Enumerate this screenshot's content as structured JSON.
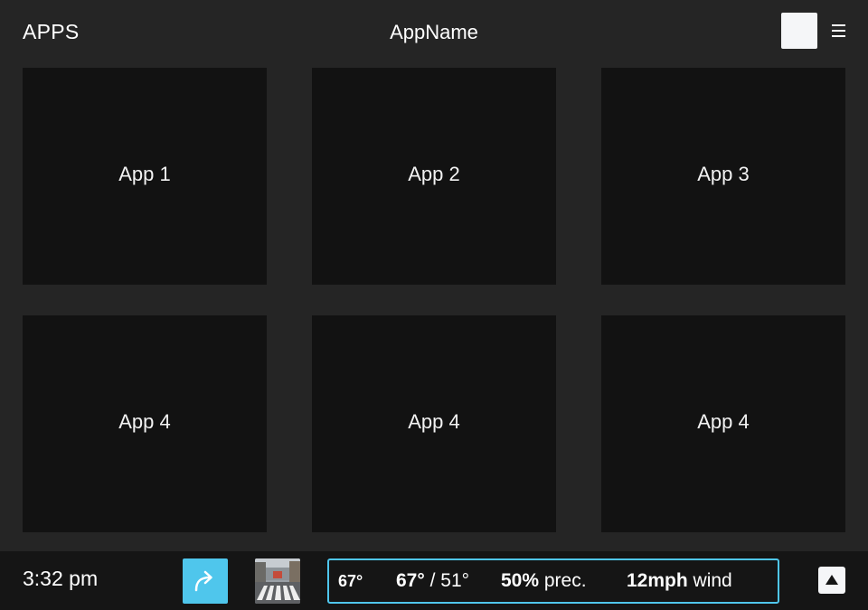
{
  "header": {
    "title": "APPS",
    "app_name": "AppName"
  },
  "tiles": [
    {
      "label": "App 1"
    },
    {
      "label": "App 2"
    },
    {
      "label": "App 3"
    },
    {
      "label": "App 4"
    },
    {
      "label": "App 4"
    },
    {
      "label": "App 4"
    }
  ],
  "bottom_bar": {
    "time": "3:32 pm",
    "nav_icon": "turn-right-arrow-icon",
    "thumbnail_icon": "street-crosswalk-thumbnail",
    "weather": {
      "current": "67°",
      "high": "67°",
      "low_sep": "/",
      "low": "51°",
      "precip_value": "50%",
      "precip_label": "prec.",
      "wind_value": "12mph",
      "wind_label": "wind"
    },
    "expand_icon": "triangle-up-icon"
  },
  "colors": {
    "background": "#252525",
    "tile": "#121212",
    "bottom_bar": "#151515",
    "accent": "#4fc6ec",
    "light_button": "#f5f6f8"
  }
}
